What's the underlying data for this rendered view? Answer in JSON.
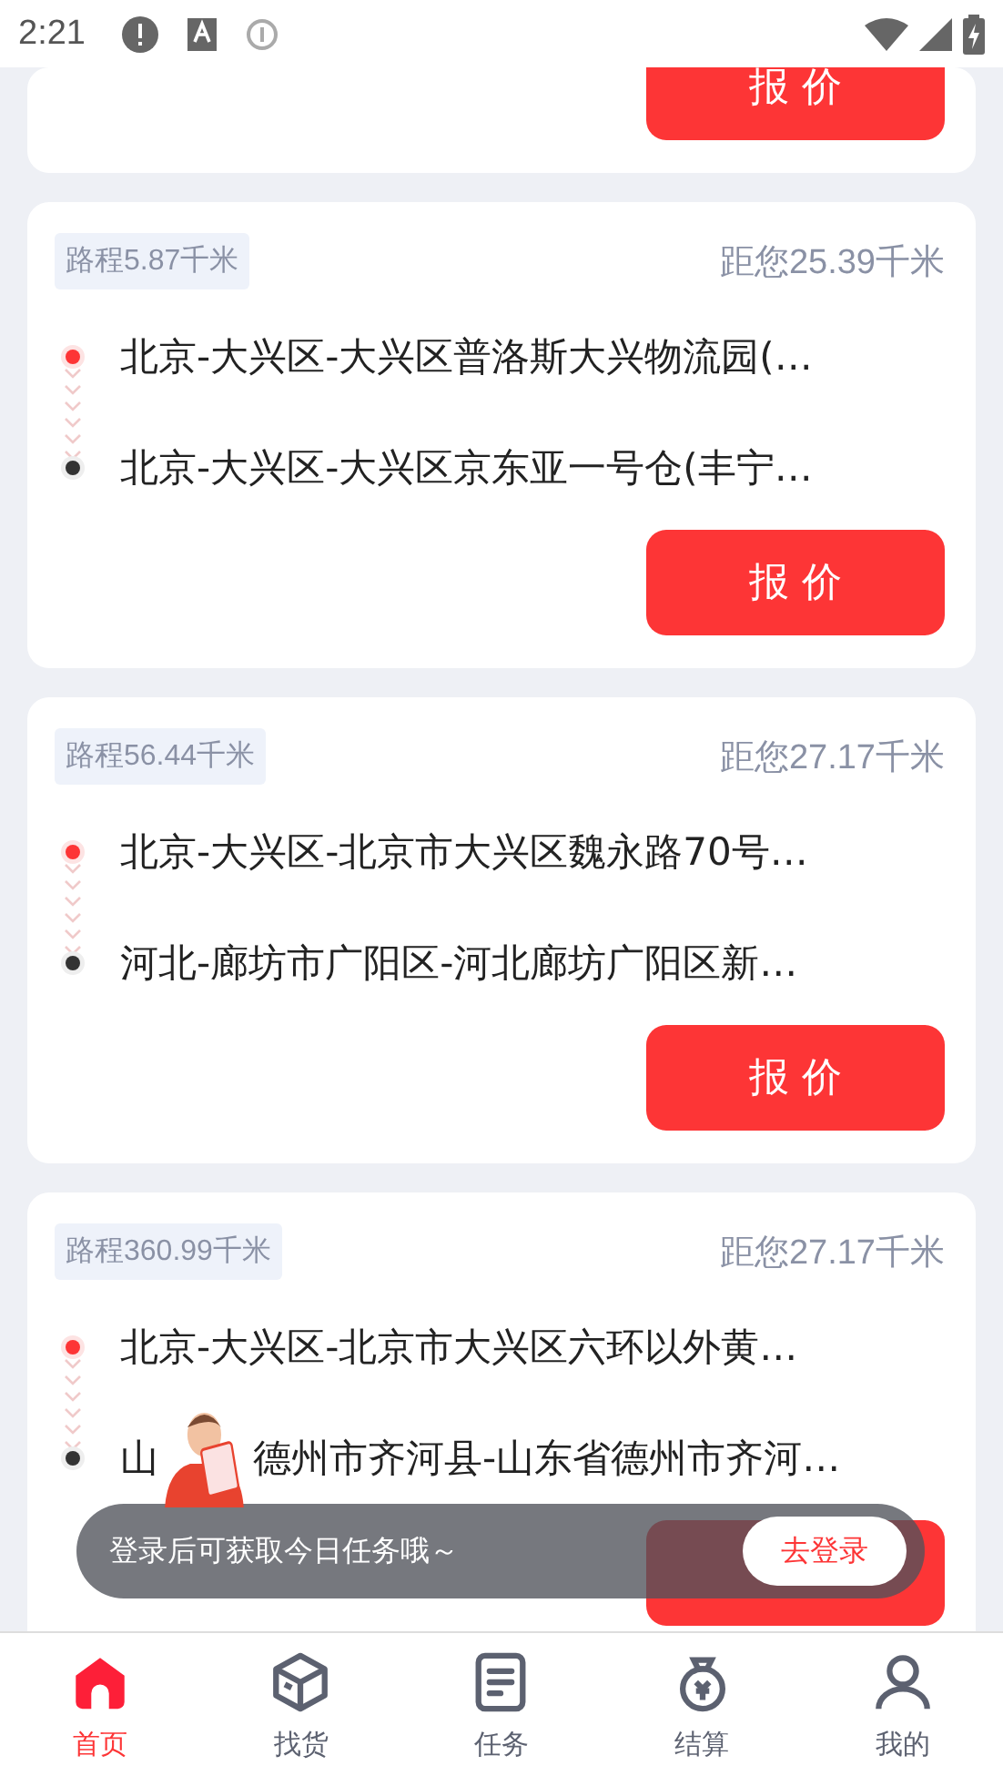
{
  "status_bar": {
    "time": "2:21"
  },
  "orders": [
    {
      "kind": "partial",
      "quote_button": "报 价"
    },
    {
      "kind": "full",
      "route_distance": "路程5.87千米",
      "distance_to_you": "距您25.39千米",
      "origin": "北京-大兴区-大兴区普洛斯大兴物流园(…",
      "destination": "北京-大兴区-大兴区京东亚一号仓(丰宁…",
      "quote_button": "报 价"
    },
    {
      "kind": "full",
      "route_distance": "路程56.44千米",
      "distance_to_you": "距您27.17千米",
      "origin": "北京-大兴区-北京市大兴区魏永路70号…",
      "destination": "河北-廊坊市广阳区-河北廊坊广阳区新…",
      "quote_button": "报 价"
    },
    {
      "kind": "full",
      "route_distance": "路程360.99千米",
      "distance_to_you": "距您27.17千米",
      "origin": "北京-大兴区-北京市大兴区六环以外黄…",
      "destination_parts": [
        "山",
        "德州市齐河县-山东省德州市齐河…"
      ]
    }
  ],
  "login_toast": {
    "message": "登录后可获取今日任务哦～",
    "button": "去登录"
  },
  "tab_bar": [
    {
      "label": "首页",
      "selected": true
    },
    {
      "label": "找货",
      "selected": false
    },
    {
      "label": "任务",
      "selected": false
    },
    {
      "label": "结算",
      "selected": false
    },
    {
      "label": "我的",
      "selected": false
    }
  ]
}
